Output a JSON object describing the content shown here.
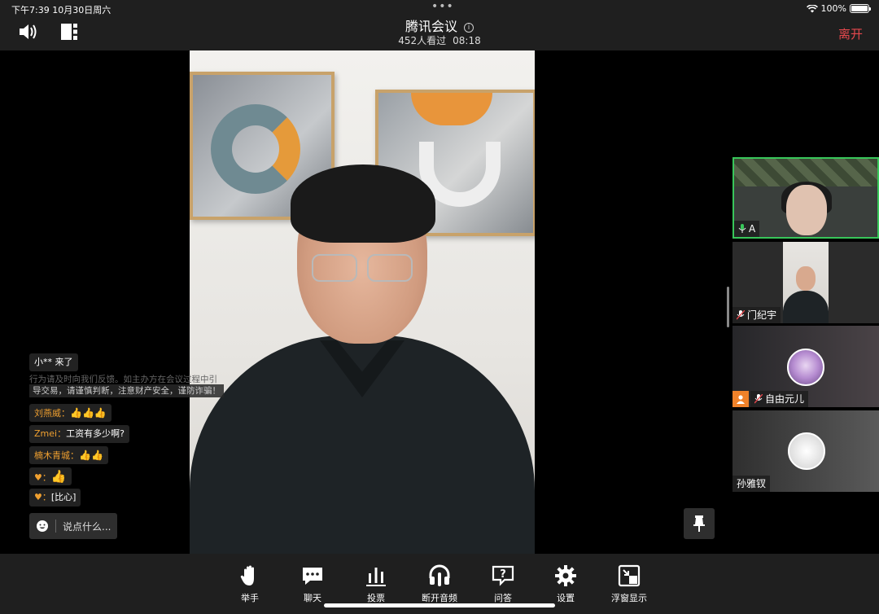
{
  "status": {
    "time_date": "下午7:39   10月30日周六",
    "battery": "100%"
  },
  "header": {
    "title": "腾讯会议",
    "info_glyph": "i",
    "viewers": "452人看过",
    "duration": "08:18",
    "leave_label": "离开"
  },
  "chat": {
    "join_notice": "小** 来了",
    "notice_line1": "行为请及时向我们反馈。如主办方在会议过程中引",
    "notice_line2": "导交易，请谨慎判断，注意财产安全，谨防诈骗！",
    "messages": [
      {
        "name": "刘燕威：",
        "text": "👍👍👍"
      },
      {
        "name": "Zmei：",
        "text": "工资有多少啊?"
      },
      {
        "name": "楠木青城：",
        "text": "👍👍"
      },
      {
        "name": "♥：",
        "text": "👍"
      },
      {
        "name": "♥：",
        "text": "[比心]"
      }
    ],
    "input_placeholder": "说点什么..."
  },
  "participants": [
    {
      "name": "A"
    },
    {
      "name": "门纪宇"
    },
    {
      "name": "自由元儿"
    },
    {
      "name": "孙雅钗"
    }
  ],
  "toolbar": {
    "raise_hand": "举手",
    "chat": "聊天",
    "poll": "投票",
    "disconnect_audio": "断开音频",
    "qa": "问答",
    "settings": "设置",
    "floating_window": "浮窗显示"
  },
  "colors": {
    "leave": "#e5484d",
    "active_speaker": "#38c65a",
    "chat_name": "#f0a030",
    "host_badge": "#f0822a"
  }
}
